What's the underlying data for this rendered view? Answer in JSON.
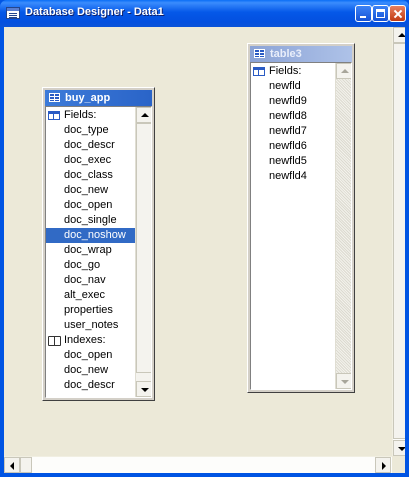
{
  "window": {
    "title": "Database Designer - Data1"
  },
  "tables": [
    {
      "name": "buy_app",
      "state": "active",
      "fields_label": "Fields:",
      "fields": [
        "doc_type",
        "doc_descr",
        "doc_exec",
        "doc_class",
        "doc_new",
        "doc_open",
        "doc_single",
        "doc_noshow",
        "doc_wrap",
        "doc_go",
        "doc_nav",
        "alt_exec",
        "properties",
        "user_notes"
      ],
      "selected_field": "doc_noshow",
      "indexes_label": "Indexes:",
      "indexes": [
        "doc_open",
        "doc_new",
        "doc_descr"
      ]
    },
    {
      "name": "table3",
      "state": "inactive",
      "fields_label": "Fields:",
      "fields": [
        "newfld",
        "newfld9",
        "newfld8",
        "newfld7",
        "newfld6",
        "newfld5",
        "newfld4"
      ]
    }
  ],
  "colors": {
    "title_bar": "#0558e8",
    "workspace": "#ece9d8",
    "selection": "#316ac5"
  },
  "icons": {
    "table_icon": "table-grid-icon",
    "fields_icon": "fields-icon",
    "indexes_icon": "indexes-book-icon"
  }
}
